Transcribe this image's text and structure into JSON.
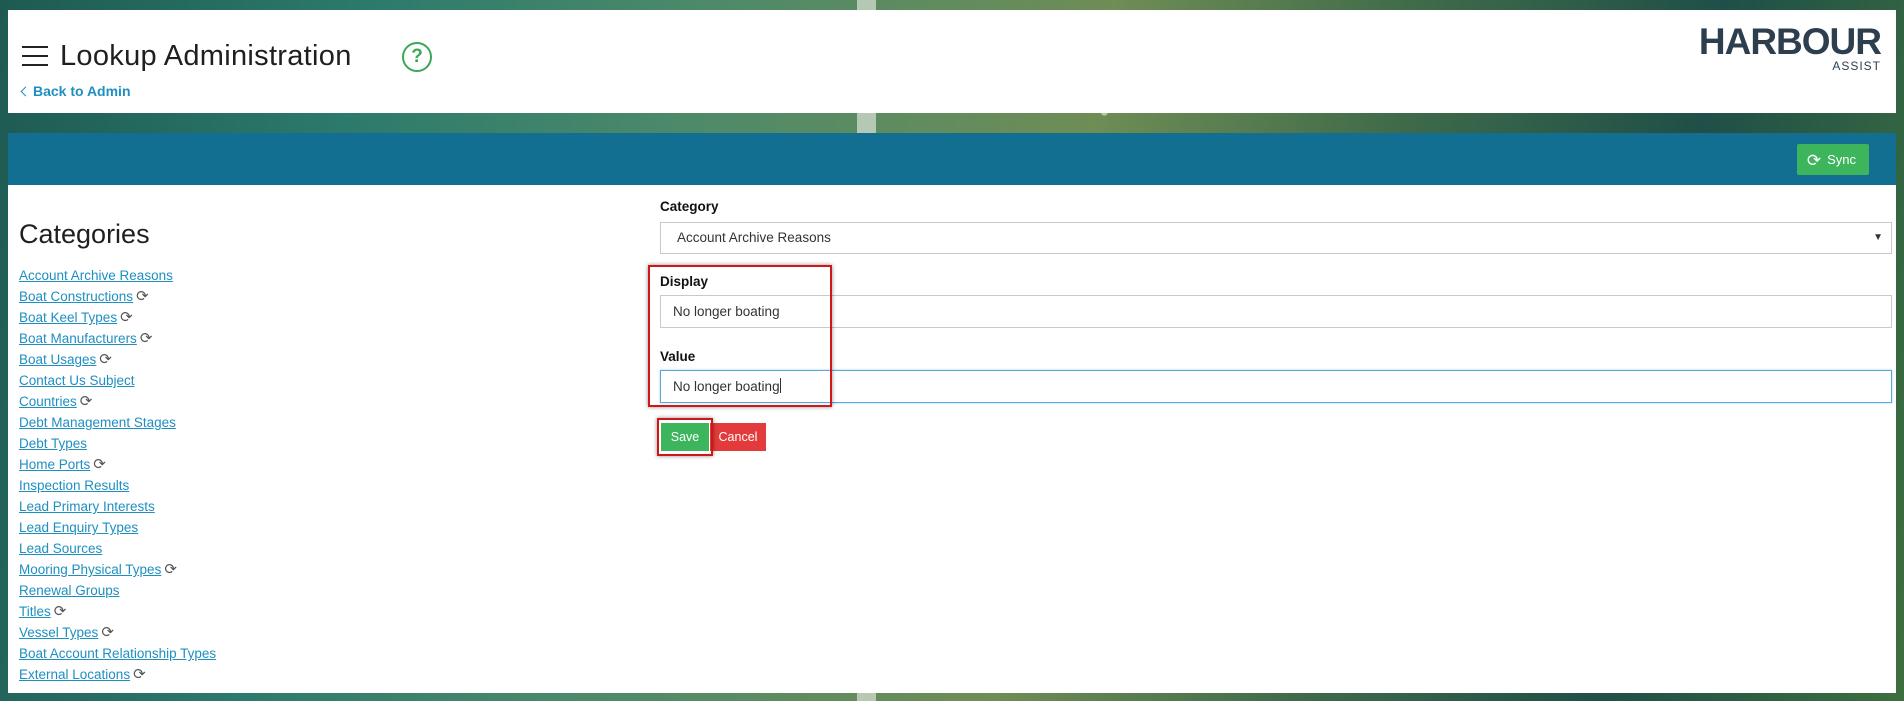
{
  "header": {
    "title": "Lookup Administration",
    "help_icon": "question-circle-icon",
    "back_link": "Back to Admin",
    "logo": {
      "main": "HARBOUR",
      "sub": "ASSIST"
    }
  },
  "toolbar": {
    "sync_label": "Sync",
    "sync_icon": "refresh-icon"
  },
  "categories": {
    "title": "Categories",
    "items": [
      {
        "label": "Account Archive Reasons",
        "sync": false
      },
      {
        "label": "Boat Constructions",
        "sync": true
      },
      {
        "label": "Boat Keel Types",
        "sync": true
      },
      {
        "label": "Boat Manufacturers",
        "sync": true
      },
      {
        "label": "Boat Usages",
        "sync": true
      },
      {
        "label": "Contact Us Subject",
        "sync": false
      },
      {
        "label": "Countries",
        "sync": true
      },
      {
        "label": "Debt Management Stages",
        "sync": false
      },
      {
        "label": "Debt Types",
        "sync": false
      },
      {
        "label": "Home Ports",
        "sync": true
      },
      {
        "label": "Inspection Results",
        "sync": false
      },
      {
        "label": "Lead Primary Interests",
        "sync": false
      },
      {
        "label": "Lead Enquiry Types",
        "sync": false
      },
      {
        "label": "Lead Sources",
        "sync": false
      },
      {
        "label": "Mooring Physical Types",
        "sync": true
      },
      {
        "label": "Renewal Groups",
        "sync": false
      },
      {
        "label": "Titles",
        "sync": true
      },
      {
        "label": "Vessel Types",
        "sync": true
      },
      {
        "label": "Boat Account Relationship Types",
        "sync": false
      },
      {
        "label": "External Locations",
        "sync": true
      }
    ]
  },
  "form": {
    "category_label": "Category",
    "category_value": "Account Archive Reasons",
    "display_label": "Display",
    "display_value": "No longer boating",
    "value_label": "Value",
    "value_value": "No longer boating",
    "save_label": "Save",
    "cancel_label": "Cancel"
  },
  "colors": {
    "toolbar": "#136f92",
    "save": "#3cb55c",
    "cancel": "#e33b3b",
    "link": "#1e8fc1",
    "highlight": "#d01616"
  }
}
